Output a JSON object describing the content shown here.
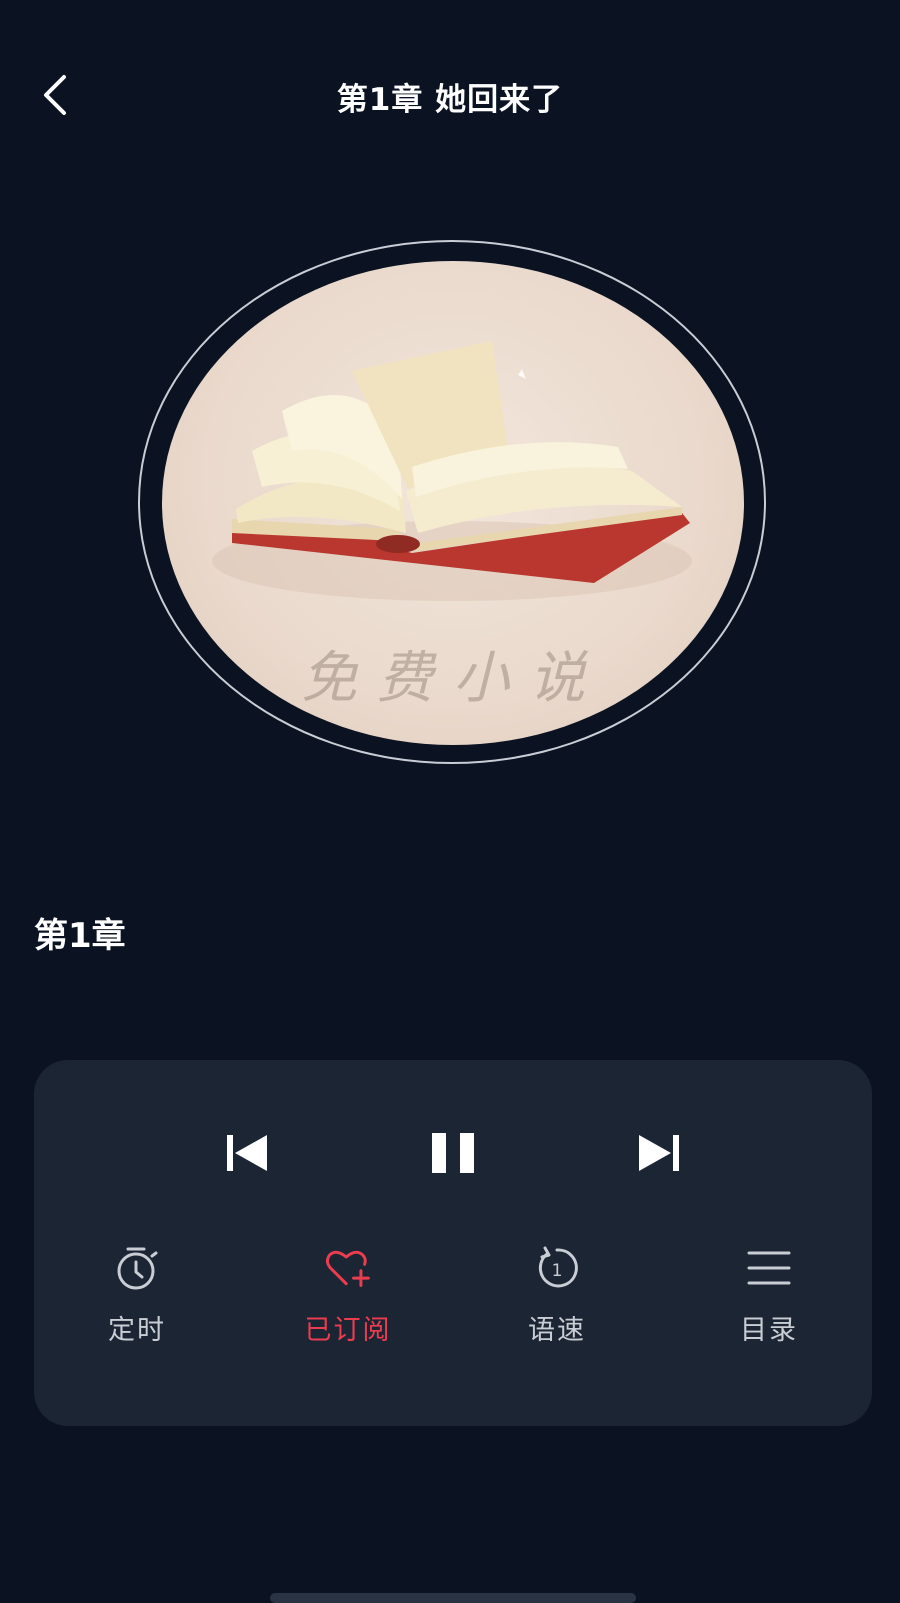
{
  "header": {
    "title": "第1章 她回来了"
  },
  "cover": {
    "watermark_text": "免费小说"
  },
  "chapter": {
    "label": "第1章"
  },
  "player": {
    "state": "playing",
    "actions": [
      {
        "label": "定时",
        "icon": "timer-icon",
        "active": false
      },
      {
        "label": "已订阅",
        "icon": "heart-plus-icon",
        "active": true
      },
      {
        "label": "语速",
        "icon": "speed-icon",
        "active": false
      },
      {
        "label": "目录",
        "icon": "menu-list-icon",
        "active": false
      }
    ]
  },
  "colors": {
    "background": "#0b1322",
    "panel": "#1c2534",
    "accent": "#ea3d4f",
    "text_muted": "#c9cdd4"
  }
}
